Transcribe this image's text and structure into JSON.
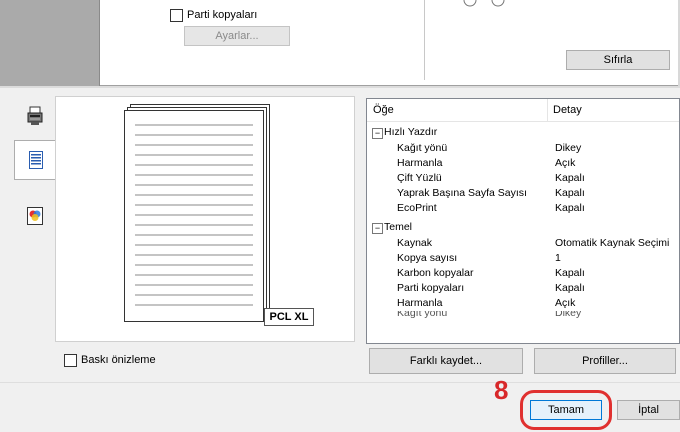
{
  "top": {
    "collate_label": "Parti kopyaları",
    "settings_button": "Ayarlar...",
    "reset_button": "Sıfırla"
  },
  "tabs": [
    {
      "icon": "printer-icon"
    },
    {
      "icon": "page-layout-icon",
      "selected": true
    },
    {
      "icon": "color-icon"
    }
  ],
  "preview": {
    "badge": "PCL XL"
  },
  "table": {
    "col_item": "Öğe",
    "col_detail": "Detay",
    "groups": [
      {
        "label": "Hızlı Yazdır",
        "rows": [
          {
            "key": "Kağıt yönü",
            "value": "Dikey"
          },
          {
            "key": "Harmanla",
            "value": "Açık"
          },
          {
            "key": "Çift Yüzlü",
            "value": "Kapalı"
          },
          {
            "key": "Yaprak Başına Sayfa Sayısı",
            "value": "Kapalı"
          },
          {
            "key": "EcoPrint",
            "value": "Kapalı"
          }
        ]
      },
      {
        "label": "Temel",
        "rows": [
          {
            "key": "Kaynak",
            "value": "Otomatik Kaynak Seçimi"
          },
          {
            "key": "Kopya sayısı",
            "value": "1"
          },
          {
            "key": "Karbon kopyalar",
            "value": "Kapalı"
          },
          {
            "key": "Parti kopyaları",
            "value": "Kapalı"
          },
          {
            "key": "Harmanla",
            "value": "Açık"
          },
          {
            "key": "Kağıt yönü",
            "value": "Dikey"
          }
        ]
      }
    ]
  },
  "bottom": {
    "print_preview_label": "Baskı önizleme",
    "save_as_button": "Farklı kaydet...",
    "profiles_button": "Profiller...",
    "ok_button": "Tamam",
    "cancel_button": "İptal",
    "step_number": "8"
  },
  "colors": {
    "highlight": "#e0302f",
    "step": "#d8282a"
  }
}
